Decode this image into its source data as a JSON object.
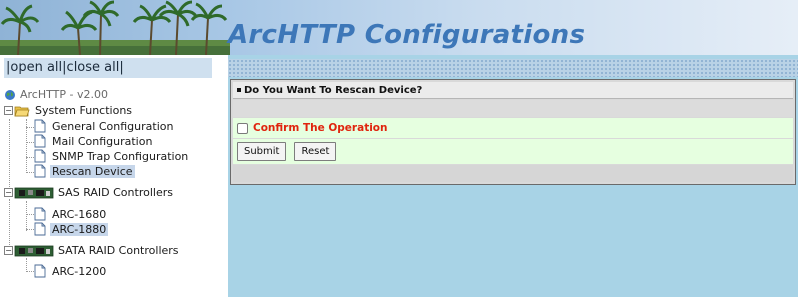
{
  "banner": {
    "title": "ArcHTTP Configurations"
  },
  "nav": {
    "open_all": "open all",
    "close_all": "close all",
    "separator": "|",
    "root": "ArcHTTP - v2.00",
    "system_functions": {
      "label": "System Functions",
      "items": [
        {
          "label": "General Configuration"
        },
        {
          "label": "Mail Configuration"
        },
        {
          "label": "SNMP Trap Configuration"
        },
        {
          "label": "Rescan Device",
          "selected": true
        }
      ]
    },
    "sas": {
      "label": "SAS RAID Controllers",
      "items": [
        {
          "label": "ARC-1680"
        },
        {
          "label": "ARC-1880",
          "selected": true
        }
      ]
    },
    "sata": {
      "label": "SATA RAID Controllers",
      "items": [
        {
          "label": "ARC-1200"
        }
      ]
    }
  },
  "form": {
    "header": "Do You Want To Rescan Device?",
    "confirm_label": "Confirm The Operation",
    "confirm_checked": false,
    "submit_label": "Submit",
    "reset_label": "Reset"
  },
  "colors": {
    "accent_title": "#3d77b8",
    "confirm_text": "#e0240e",
    "main_bg": "#a8d3e6",
    "confirm_row_bg": "#e6ffe0",
    "selected_bg": "#c6d6ea"
  }
}
